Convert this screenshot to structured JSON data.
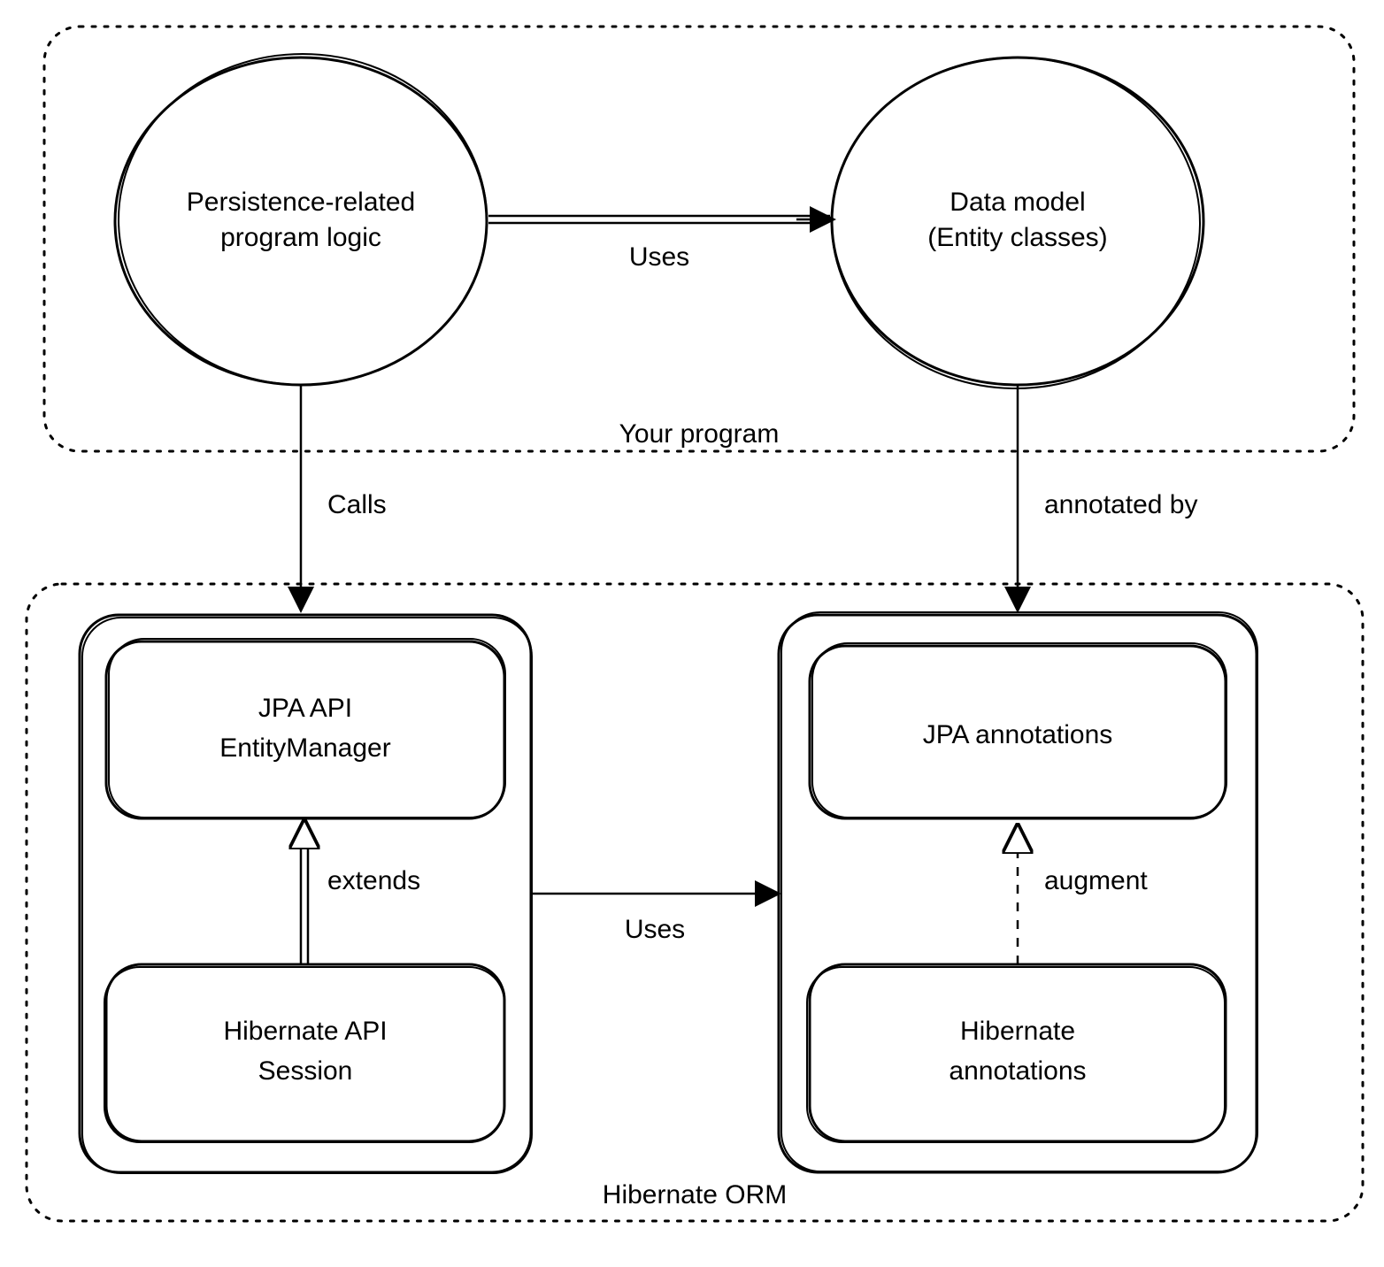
{
  "groups": {
    "yourProgram": {
      "label": "Your program"
    },
    "hibernateOrm": {
      "label": "Hibernate ORM"
    }
  },
  "nodes": {
    "programLogic": {
      "line1": "Persistence-related",
      "line2": "program logic"
    },
    "dataModel": {
      "line1": "Data model",
      "line2": "(Entity classes)"
    },
    "jpaApi": {
      "line1": "JPA API",
      "line2": "EntityManager"
    },
    "hibApi": {
      "line1": "Hibernate API",
      "line2": "Session"
    },
    "jpaAnn": {
      "line1": "JPA annotations"
    },
    "hibAnn": {
      "line1": "Hibernate",
      "line2": "annotations"
    }
  },
  "edges": {
    "uses1": {
      "label": "Uses"
    },
    "calls": {
      "label": "Calls"
    },
    "annotatedBy": {
      "label": "annotated by"
    },
    "extends": {
      "label": "extends"
    },
    "uses2": {
      "label": "Uses"
    },
    "augment": {
      "label": "augment"
    }
  }
}
